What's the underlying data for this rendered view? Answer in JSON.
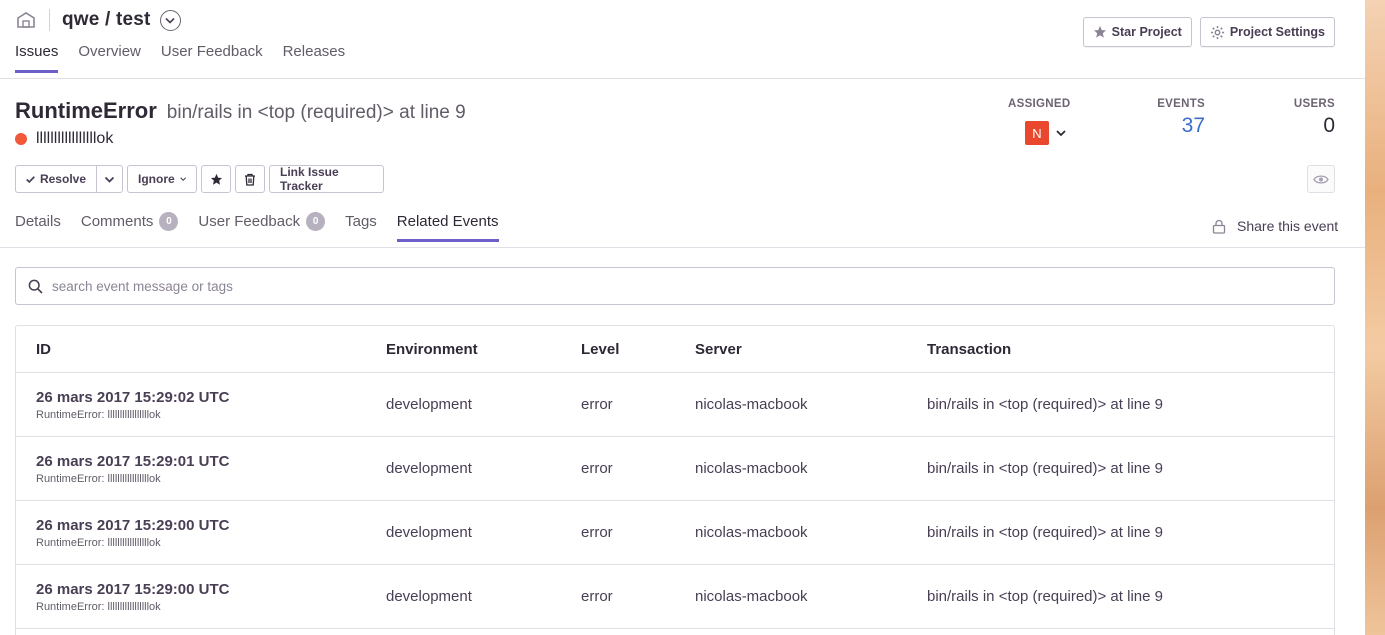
{
  "project": {
    "name": "qwe / test"
  },
  "nav_tabs": [
    {
      "label": "Issues",
      "active": true
    },
    {
      "label": "Overview",
      "active": false
    },
    {
      "label": "User Feedback",
      "active": false
    },
    {
      "label": "Releases",
      "active": false
    }
  ],
  "header_buttons": {
    "star": "Star Project",
    "settings": "Project Settings"
  },
  "issue": {
    "type": "RuntimeError",
    "culprit": "bin/rails in <top (required)> at line 9",
    "message": "lllllllllllllllllok",
    "level_color": "#f1593a"
  },
  "stats": {
    "assigned_label": "ASSIGNED",
    "assignee_initial": "N",
    "events_label": "EVENTS",
    "events_value": "37",
    "users_label": "USERS",
    "users_value": "0"
  },
  "actions": {
    "resolve": "Resolve",
    "ignore": "Ignore",
    "link_tracker": "Link Issue Tracker"
  },
  "sub_tabs": [
    {
      "label": "Details",
      "badge": null,
      "active": false
    },
    {
      "label": "Comments",
      "badge": "0",
      "active": false
    },
    {
      "label": "User Feedback",
      "badge": "0",
      "active": false
    },
    {
      "label": "Tags",
      "badge": null,
      "active": false
    },
    {
      "label": "Related Events",
      "badge": null,
      "active": true
    }
  ],
  "share_label": "Share this event",
  "search": {
    "placeholder": "search event message or tags"
  },
  "table": {
    "headers": [
      "ID",
      "Environment",
      "Level",
      "Server",
      "Transaction"
    ],
    "rows": [
      {
        "timestamp": "26 mars 2017 15:29:02 UTC",
        "message": "RuntimeError: lllllllllllllllllok",
        "environment": "development",
        "level": "error",
        "server": "nicolas-macbook",
        "transaction": "bin/rails in <top (required)> at line 9"
      },
      {
        "timestamp": "26 mars 2017 15:29:01 UTC",
        "message": "RuntimeError: lllllllllllllllllok",
        "environment": "development",
        "level": "error",
        "server": "nicolas-macbook",
        "transaction": "bin/rails in <top (required)> at line 9"
      },
      {
        "timestamp": "26 mars 2017 15:29:00 UTC",
        "message": "RuntimeError: lllllllllllllllllok",
        "environment": "development",
        "level": "error",
        "server": "nicolas-macbook",
        "transaction": "bin/rails in <top (required)> at line 9"
      },
      {
        "timestamp": "26 mars 2017 15:29:00 UTC",
        "message": "RuntimeError: lllllllllllllllllok",
        "environment": "development",
        "level": "error",
        "server": "nicolas-macbook",
        "transaction": "bin/rails in <top (required)> at line 9"
      }
    ]
  },
  "colors": {
    "accent": "#6c5fc7",
    "link": "#3b6ecc",
    "avatar": "#e9482f"
  }
}
